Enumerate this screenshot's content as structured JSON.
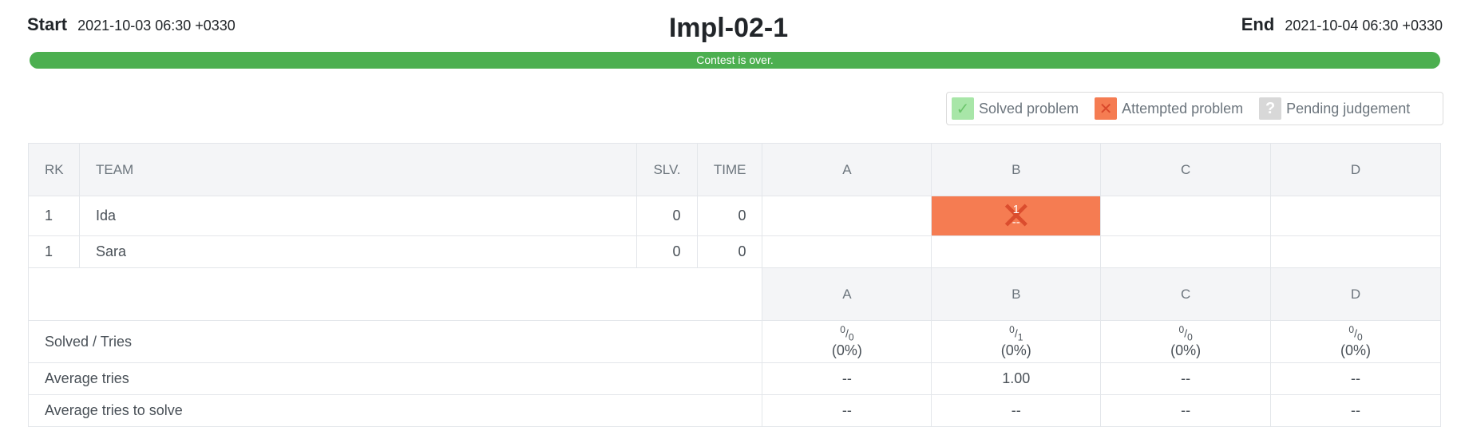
{
  "header": {
    "start_label": "Start",
    "start_time": "2021-10-03 06:30 +0330",
    "title": "Impl-02-1",
    "end_label": "End",
    "end_time": "2021-10-04 06:30 +0330",
    "progress_text": "Contest is over.",
    "progress_fraction": 1.0
  },
  "legend": {
    "solved": "Solved problem",
    "attempted": "Attempted problem",
    "pending": "Pending judgement"
  },
  "columns": {
    "rank": "RK",
    "team": "TEAM",
    "solved": "SLV.",
    "time": "TIME",
    "problems": [
      "A",
      "B",
      "C",
      "D"
    ]
  },
  "teams": [
    {
      "rank": "1",
      "name": "Ida",
      "solved": "0",
      "time": "0",
      "B_tries": "1",
      "B_time": "--"
    },
    {
      "rank": "1",
      "name": "Sara",
      "solved": "0",
      "time": "0"
    }
  ],
  "stats": {
    "problems": [
      "A",
      "B",
      "C",
      "D"
    ],
    "solved_tries_label": "Solved / Tries",
    "solved_tries": [
      {
        "solved": "0",
        "tries": "0",
        "pct": "(0%)"
      },
      {
        "solved": "0",
        "tries": "1",
        "pct": "(0%)"
      },
      {
        "solved": "0",
        "tries": "0",
        "pct": "(0%)"
      },
      {
        "solved": "0",
        "tries": "0",
        "pct": "(0%)"
      }
    ],
    "avg_tries_label": "Average tries",
    "avg_tries": [
      "--",
      "1.00",
      "--",
      "--"
    ],
    "avg_tries_solve_label": "Average tries to solve",
    "avg_tries_solve": [
      "--",
      "--",
      "--",
      "--"
    ]
  },
  "colors": {
    "progress": "#4caf50",
    "attempted": "#f57c52",
    "solved": "#a8e6a8",
    "pending": "#d8d8d8",
    "problem_label": "#3a7fc4"
  }
}
